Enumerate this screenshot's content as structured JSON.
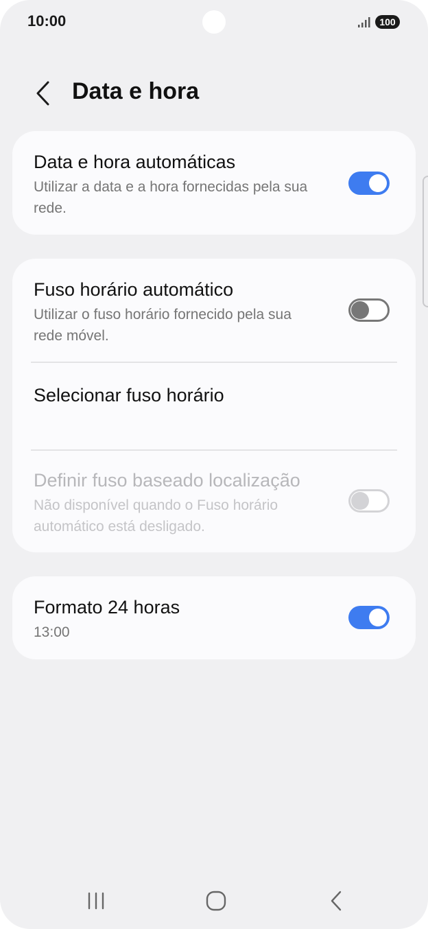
{
  "status_bar": {
    "time": "10:00",
    "battery": "100"
  },
  "header": {
    "title": "Data e hora"
  },
  "settings": {
    "auto_datetime": {
      "title": "Data e hora automáticas",
      "subtitle": "Utilizar a data e a hora fornecidas pela sua rede.",
      "enabled": true
    },
    "auto_timezone": {
      "title": "Fuso horário automático",
      "subtitle": "Utilizar o fuso horário fornecido pela sua rede móvel.",
      "enabled": false
    },
    "select_timezone": {
      "title": "Selecionar fuso horário"
    },
    "location_timezone": {
      "title": "Definir fuso baseado localização",
      "subtitle": "Não disponível quando o Fuso horário automático está desligado.",
      "enabled": false,
      "disabled": true
    },
    "format_24h": {
      "title": "Formato 24 horas",
      "subtitle": "13:00",
      "enabled": true
    }
  },
  "nav_bar": {
    "icons": [
      "recent-apps-icon",
      "home-icon",
      "back-icon"
    ]
  },
  "colors": {
    "accent": "#3e7cf0",
    "background": "#f0f0f2",
    "card": "#fbfbfd"
  }
}
